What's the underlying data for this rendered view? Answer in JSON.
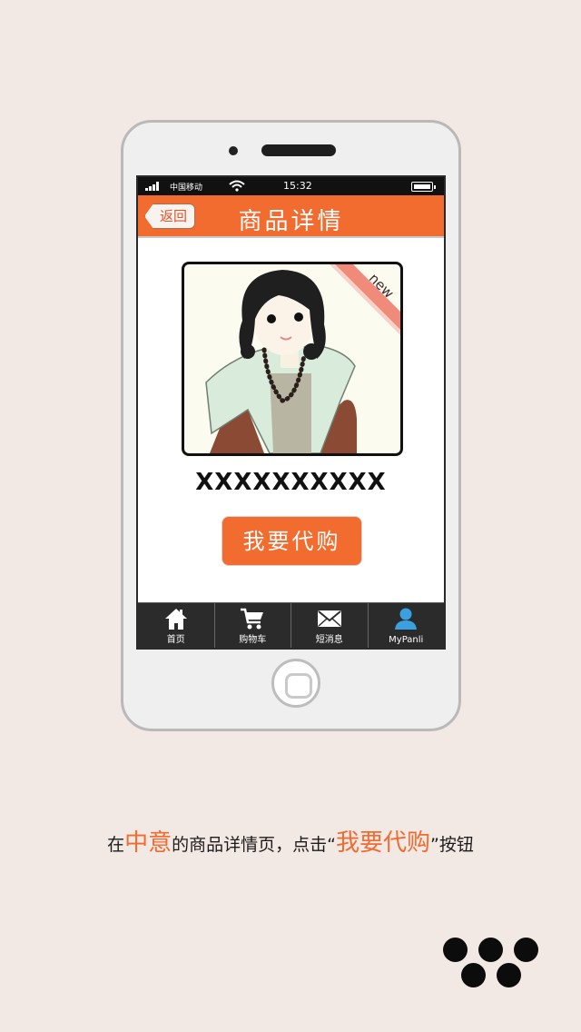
{
  "status_bar": {
    "carrier": "中国移动",
    "time": "15:32"
  },
  "header": {
    "back_label": "返回",
    "title": "商品详情"
  },
  "product": {
    "badge": "new",
    "name": "XXXXXXXXXX",
    "buy_label": "我要代购"
  },
  "tabs": [
    {
      "label": "首页",
      "icon": "home-icon"
    },
    {
      "label": "购物车",
      "icon": "cart-icon"
    },
    {
      "label": "短消息",
      "icon": "mail-icon"
    },
    {
      "label": "MyPanli",
      "icon": "user-icon"
    }
  ],
  "caption": {
    "part1": "在",
    "hl1": "中意",
    "part2": "的商品详情页，点击“",
    "hl2": "我要代购",
    "part3": "”按钮"
  },
  "colors": {
    "accent": "#f26b2f",
    "background": "#f2e8e4",
    "tabbar": "#2b2b2b",
    "active_tab": "#3aa0e0"
  }
}
